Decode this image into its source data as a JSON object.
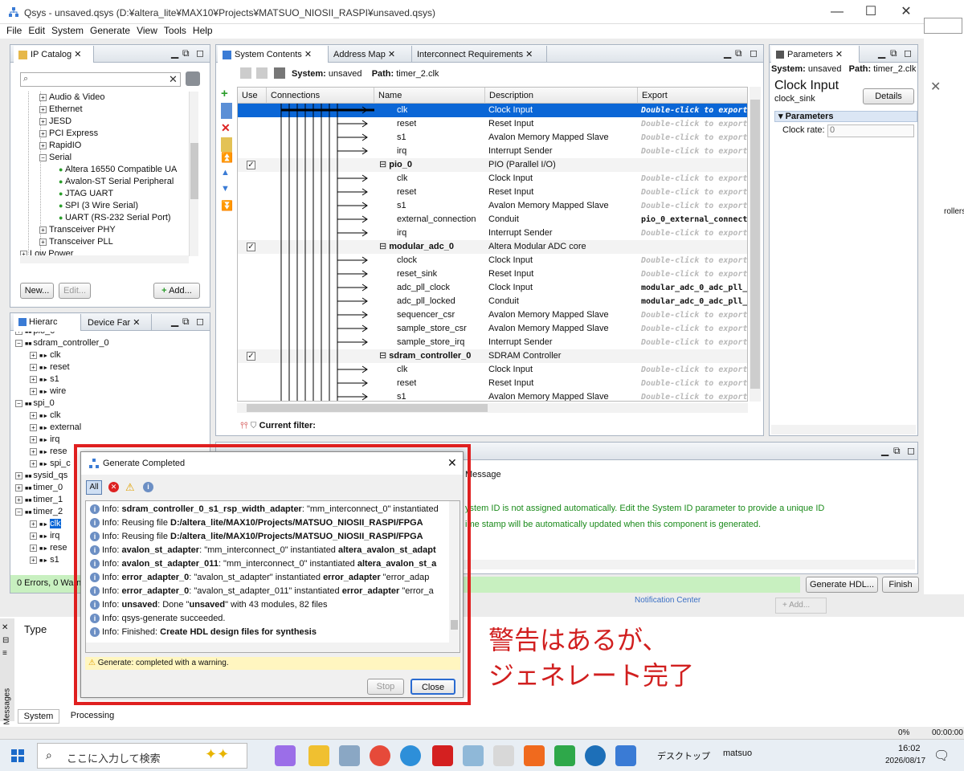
{
  "window": {
    "title": "Qsys - unsaved.qsys (D:¥altera_lite¥MAX10¥Projects¥MATSUO_NIOSII_RASPI¥unsaved.qsys)"
  },
  "menu": [
    "File",
    "Edit",
    "System",
    "Generate",
    "View",
    "Tools",
    "Help"
  ],
  "ip_catalog": {
    "tab": "IP Catalog",
    "items": [
      {
        "label": "Audio & Video",
        "depth": 1,
        "exp": "+"
      },
      {
        "label": "Ethernet",
        "depth": 1,
        "exp": "+"
      },
      {
        "label": "JESD",
        "depth": 1,
        "exp": "+"
      },
      {
        "label": "PCI Express",
        "depth": 1,
        "exp": "+"
      },
      {
        "label": "RapidIO",
        "depth": 1,
        "exp": "+"
      },
      {
        "label": "Serial",
        "depth": 1,
        "exp": "−"
      },
      {
        "label": "Altera 16550 Compatible UA",
        "depth": 2,
        "exp": ""
      },
      {
        "label": "Avalon-ST Serial Peripheral",
        "depth": 2,
        "exp": ""
      },
      {
        "label": "JTAG UART",
        "depth": 2,
        "exp": ""
      },
      {
        "label": "SPI (3 Wire Serial)",
        "depth": 2,
        "exp": ""
      },
      {
        "label": "UART (RS-232 Serial Port)",
        "depth": 2,
        "exp": ""
      },
      {
        "label": "Transceiver PHY",
        "depth": 1,
        "exp": "+"
      },
      {
        "label": "Transceiver PLL",
        "depth": 1,
        "exp": "+"
      },
      {
        "label": "Low Power",
        "depth": 0,
        "exp": "+"
      }
    ],
    "new_btn": "New...",
    "edit_btn": "Edit...",
    "add_btn": "Add..."
  },
  "hierarchy": {
    "tab1": "Hierarc",
    "tab2": "Device Far",
    "items": [
      {
        "label": "pio_0",
        "depth": 0,
        "exp": "+"
      },
      {
        "label": "sdram_controller_0",
        "depth": 0,
        "exp": "−"
      },
      {
        "label": "clk",
        "depth": 1,
        "exp": "+"
      },
      {
        "label": "reset",
        "depth": 1,
        "exp": "+"
      },
      {
        "label": "s1",
        "depth": 1,
        "exp": "+"
      },
      {
        "label": "wire",
        "depth": 1,
        "exp": "+"
      },
      {
        "label": "spi_0",
        "depth": 0,
        "exp": "−"
      },
      {
        "label": "clk",
        "depth": 1,
        "exp": "+"
      },
      {
        "label": "external",
        "depth": 1,
        "exp": "+"
      },
      {
        "label": "irq",
        "depth": 1,
        "exp": "+"
      },
      {
        "label": "rese",
        "depth": 1,
        "exp": "+"
      },
      {
        "label": "spi_c",
        "depth": 1,
        "exp": "+"
      },
      {
        "label": "sysid_qs",
        "depth": 0,
        "exp": "+"
      },
      {
        "label": "timer_0",
        "depth": 0,
        "exp": "+"
      },
      {
        "label": "timer_1",
        "depth": 0,
        "exp": "+"
      },
      {
        "label": "timer_2",
        "depth": 0,
        "exp": "−"
      },
      {
        "label": "clk",
        "depth": 1,
        "exp": "+"
      },
      {
        "label": "irq",
        "depth": 1,
        "exp": "+"
      },
      {
        "label": "rese",
        "depth": 1,
        "exp": "+"
      },
      {
        "label": "s1",
        "depth": 1,
        "exp": "+"
      }
    ],
    "status": "0 Errors, 0 Warn"
  },
  "system_contents": {
    "tabs": [
      "System Contents",
      "Address Map",
      "Interconnect Requirements"
    ],
    "system_label": "System:",
    "system_value": "unsaved",
    "path_label": "Path:",
    "path_value": "timer_2.clk",
    "columns": [
      "Use",
      "Connections",
      "Name",
      "Description",
      "Export"
    ],
    "rows": [
      {
        "name": "clk",
        "desc": "Clock Input",
        "export": "Double-click to export",
        "sel": true
      },
      {
        "name": "reset",
        "desc": "Reset Input",
        "export": "Double-click to export"
      },
      {
        "name": "s1",
        "desc": "Avalon Memory Mapped Slave",
        "export": "Double-click to export"
      },
      {
        "name": "irq",
        "desc": "Interrupt Sender",
        "export": "Double-click to export"
      },
      {
        "name": "pio_0",
        "desc": "PIO (Parallel I/O)",
        "export": "",
        "top": true,
        "check": true
      },
      {
        "name": "clk",
        "desc": "Clock Input",
        "export": "Double-click to export"
      },
      {
        "name": "reset",
        "desc": "Reset Input",
        "export": "Double-click to export"
      },
      {
        "name": "s1",
        "desc": "Avalon Memory Mapped Slave",
        "export": "Double-click to export"
      },
      {
        "name": "external_connection",
        "desc": "Conduit",
        "export": "pio_0_external_connect...",
        "bold": true
      },
      {
        "name": "irq",
        "desc": "Interrupt Sender",
        "export": "Double-click to export"
      },
      {
        "name": "modular_adc_0",
        "desc": "Altera Modular ADC core",
        "export": "",
        "top": true,
        "check": true
      },
      {
        "name": "clock",
        "desc": "Clock Input",
        "export": "Double-click to export"
      },
      {
        "name": "reset_sink",
        "desc": "Reset Input",
        "export": "Double-click to export"
      },
      {
        "name": "adc_pll_clock",
        "desc": "Clock Input",
        "export": "modular_adc_0_adc_pll_...",
        "bold": true
      },
      {
        "name": "adc_pll_locked",
        "desc": "Conduit",
        "export": "modular_adc_0_adc_pll_...",
        "bold": true
      },
      {
        "name": "sequencer_csr",
        "desc": "Avalon Memory Mapped Slave",
        "export": "Double-click to export"
      },
      {
        "name": "sample_store_csr",
        "desc": "Avalon Memory Mapped Slave",
        "export": "Double-click to export"
      },
      {
        "name": "sample_store_irq",
        "desc": "Interrupt Sender",
        "export": "Double-click to export"
      },
      {
        "name": "sdram_controller_0",
        "desc": "SDRAM Controller",
        "export": "",
        "top": true,
        "check": true
      },
      {
        "name": "clk",
        "desc": "Clock Input",
        "export": "Double-click to export"
      },
      {
        "name": "reset",
        "desc": "Reset Input",
        "export": "Double-click to export"
      },
      {
        "name": "s1",
        "desc": "Avalon Memory Mapped Slave",
        "export": "Double-click to export"
      }
    ],
    "filter": "Current filter:"
  },
  "parameters": {
    "tab": "Parameters",
    "system_label": "System:",
    "system_value": "unsaved",
    "path_label": "Path:",
    "path_value": "timer_2.clk",
    "title": "Clock Input",
    "subtitle": "clock_sink",
    "details_btn": "Details",
    "section": "Parameters",
    "field_label": "Clock rate:",
    "field_value": "0"
  },
  "messages": {
    "header": "Message",
    "row1": "ystem ID is not assigned automatically. Edit the System ID parameter to provide a unique ID",
    "row2": "ime stamp will be automatically updated when this component is generated.",
    "generate_btn": "Generate HDL...",
    "finish_btn": "Finish"
  },
  "dialog": {
    "title": "Generate Completed",
    "filter_all": "All",
    "lines": [
      [
        {
          "t": "Info: "
        },
        {
          "t": "sdram_controller_0_s1_rsp_width_adapter",
          "b": true
        },
        {
          "t": ": \"mm_interconnect_0\" instantiated "
        }
      ],
      [
        {
          "t": "Info: Reusing file "
        },
        {
          "t": "D:/altera_lite/MAX10/Projects/MATSUO_NIOSII_RASPI/FPGA",
          "b": true
        }
      ],
      [
        {
          "t": "Info: Reusing file "
        },
        {
          "t": "D:/altera_lite/MAX10/Projects/MATSUO_NIOSII_RASPI/FPGA",
          "b": true
        }
      ],
      [
        {
          "t": "Info: "
        },
        {
          "t": "avalon_st_adapter",
          "b": true
        },
        {
          "t": ": \"mm_interconnect_0\" instantiated "
        },
        {
          "t": "altera_avalon_st_adapt",
          "b": true
        }
      ],
      [
        {
          "t": "Info: "
        },
        {
          "t": "avalon_st_adapter_011",
          "b": true
        },
        {
          "t": ": \"mm_interconnect_0\" instantiated "
        },
        {
          "t": "altera_avalon_st_a",
          "b": true
        }
      ],
      [
        {
          "t": "Info: "
        },
        {
          "t": "error_adapter_0",
          "b": true
        },
        {
          "t": ": \"avalon_st_adapter\" instantiated "
        },
        {
          "t": "error_adapter",
          "b": true
        },
        {
          "t": " \"error_adap"
        }
      ],
      [
        {
          "t": "Info: "
        },
        {
          "t": "error_adapter_0",
          "b": true
        },
        {
          "t": ": \"avalon_st_adapter_011\" instantiated "
        },
        {
          "t": "error_adapter",
          "b": true
        },
        {
          "t": " \"error_a"
        }
      ],
      [
        {
          "t": "Info: "
        },
        {
          "t": "unsaved",
          "b": true
        },
        {
          "t": ": Done \""
        },
        {
          "t": "unsaved",
          "b": true
        },
        {
          "t": "\" with 43 modules, 82 files"
        }
      ],
      [
        {
          "t": "Info: qsys-generate succeeded."
        }
      ],
      [
        {
          "t": "Info: Finished: "
        },
        {
          "t": "Create HDL design files for synthesis",
          "b": true
        }
      ]
    ],
    "status": "Generate: completed with a warning.",
    "stop_btn": "Stop",
    "close_btn": "Close"
  },
  "annotation": {
    "line1": "警告はあるが、",
    "line2": "ジェネレート完了"
  },
  "bg_right": {
    "text": "rollers",
    "notif": "Notification Center",
    "add": "+ Add..."
  },
  "bottom": {
    "type_col": "Type",
    "tab_system": "System",
    "tab_processing": "Processing",
    "side_label": "Messages"
  },
  "taskbar": {
    "search": "ここに入力して検索",
    "desktop": "デスクトップ",
    "user": "matsuo",
    "time": "16:02",
    "date": "2026/08/17",
    "pct": "0%",
    "elapsed": "00:00:00"
  },
  "colors": {
    "accent": "#0a66d6",
    "selected_row": "#0a66d6",
    "annotation": "#d11f1f",
    "dialog_border": "#e02020"
  }
}
